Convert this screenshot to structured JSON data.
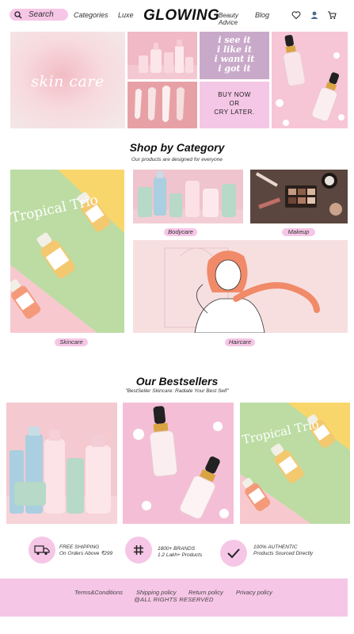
{
  "header": {
    "search_placeholder": "Search",
    "nav": {
      "categories": "Categories",
      "luxe": "Luxe",
      "beauty_advice_line1": "Beauty",
      "beauty_advice_line2": "Advice",
      "blog": "Blog"
    },
    "logo": "GLOWING",
    "icons": [
      "search-icon",
      "heart-icon",
      "user-icon",
      "cart-icon"
    ]
  },
  "hero": {
    "skin_care_text": "skin care",
    "quote_lines": [
      "i see it",
      "i like it",
      "i want it",
      "i got it"
    ],
    "buy_lines": [
      "BUY NOW",
      "OR",
      "CRY LATER."
    ]
  },
  "categories_section": {
    "title": "Shop by Category",
    "subtitle": "Our products are designed for everyone",
    "items": [
      {
        "label": "Skincare"
      },
      {
        "label": "Bodycare"
      },
      {
        "label": "Makeup"
      },
      {
        "label": "Haircare"
      }
    ],
    "tropical_trio_text": "Tropical Trio"
  },
  "bestsellers": {
    "title": "Our Bestsellers",
    "subtitle": "\"BestSeller Skincare: Radiate Your Best Self\"",
    "tropical_trio_text": "Tropical Trio"
  },
  "features": [
    {
      "icon": "truck-icon",
      "line1": "FREE SHIPPING",
      "line2": "On Orders Above ₹299"
    },
    {
      "icon": "hashtag-icon",
      "line1": "1800+ BRANDS",
      "line2": "1.2 Lakh+ Products"
    },
    {
      "icon": "check-icon",
      "line1": "100% AUTHENTIC",
      "line2": "Products Sourced Directly"
    }
  ],
  "footer": {
    "links": [
      "Terms&Conditions",
      "Shipping policy",
      "Return policy",
      "Privacy policy"
    ],
    "rights": "@ALL RIGHTS RESERVED"
  },
  "colors": {
    "accent_pink": "#f6c6e6",
    "footer_pink": "#f6c6e6",
    "tropical_green": "#bcdca3"
  }
}
